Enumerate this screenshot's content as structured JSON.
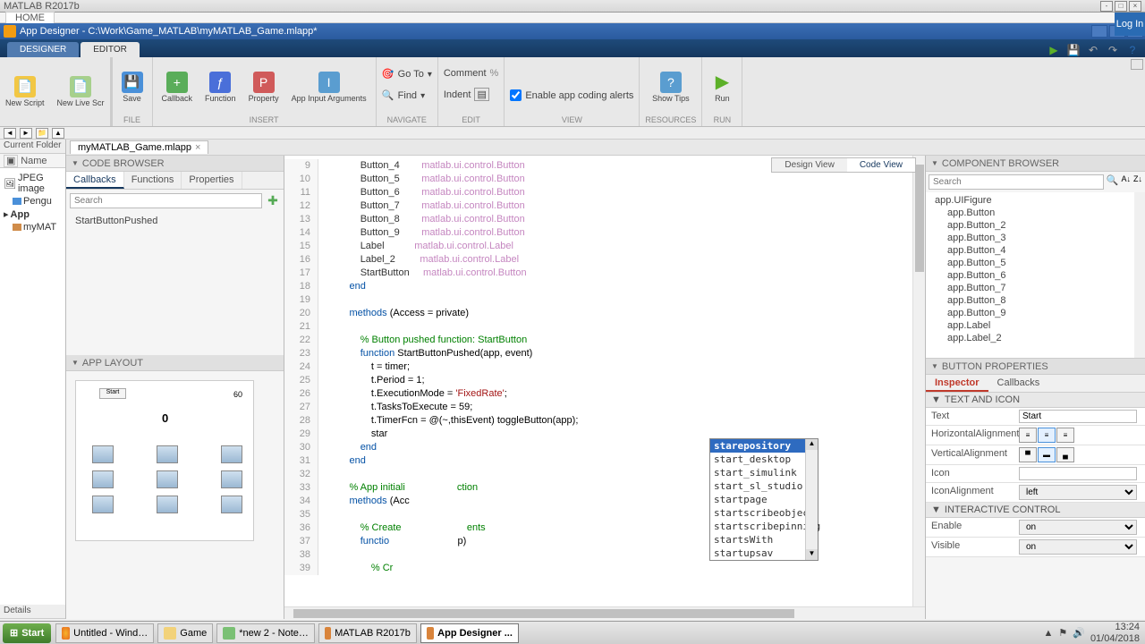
{
  "matlab_title": "MATLAB R2017b",
  "app_title": "App Designer - C:\\Work\\Game_MATLAB\\myMATLAB_Game.mlapp*",
  "home_tab": "HOME",
  "login": "Log In",
  "toolstrip": {
    "designer": "DESIGNER",
    "editor": "EDITOR"
  },
  "ribbon": {
    "new_script": "New\nScript",
    "new_livescript": "New\nLive Scr",
    "save": "Save",
    "callback": "Callback",
    "function": "Function",
    "property": "Property",
    "appinput": "App Input\nArguments",
    "goto": "Go To",
    "find": "Find",
    "comment": "Comment",
    "indent": "Indent",
    "enable_hints": "Enable app coding alerts",
    "show_tips": "Show Tips",
    "run": "Run",
    "g_file": "FILE",
    "g_insert": "INSERT",
    "g_navigate": "NAVIGATE",
    "g_edit": "EDIT",
    "g_view": "VIEW",
    "g_resources": "RESOURCES",
    "g_run": "RUN"
  },
  "current_folder": "Current Folder",
  "name_col": "Name",
  "folder_items": [
    "JPEG image",
    "Pengu",
    "App",
    "myMAT"
  ],
  "file_tab": "myMATLAB_Game.mlapp",
  "code_browser": {
    "title": "CODE BROWSER",
    "tabs": [
      "Callbacks",
      "Functions",
      "Properties"
    ],
    "search_ph": "Search",
    "item": "StartButtonPushed"
  },
  "app_layout": {
    "title": "APP LAYOUT",
    "start": "Start",
    "sixty": "60",
    "zero": "0"
  },
  "view_toggle": {
    "design": "Design View",
    "code": "Code View"
  },
  "code_lines": [
    {
      "n": 9,
      "indent": 3,
      "parts": [
        {
          "c": "prop",
          "t": "Button_4        "
        },
        {
          "c": "type",
          "t": "matlab.ui.control.Button"
        }
      ]
    },
    {
      "n": 10,
      "indent": 3,
      "parts": [
        {
          "c": "prop",
          "t": "Button_5        "
        },
        {
          "c": "type",
          "t": "matlab.ui.control.Button"
        }
      ]
    },
    {
      "n": 11,
      "indent": 3,
      "parts": [
        {
          "c": "prop",
          "t": "Button_6        "
        },
        {
          "c": "type",
          "t": "matlab.ui.control.Button"
        }
      ]
    },
    {
      "n": 12,
      "indent": 3,
      "parts": [
        {
          "c": "prop",
          "t": "Button_7        "
        },
        {
          "c": "type",
          "t": "matlab.ui.control.Button"
        }
      ]
    },
    {
      "n": 13,
      "indent": 3,
      "parts": [
        {
          "c": "prop",
          "t": "Button_8        "
        },
        {
          "c": "type",
          "t": "matlab.ui.control.Button"
        }
      ]
    },
    {
      "n": 14,
      "indent": 3,
      "parts": [
        {
          "c": "prop",
          "t": "Button_9        "
        },
        {
          "c": "type",
          "t": "matlab.ui.control.Button"
        }
      ]
    },
    {
      "n": 15,
      "indent": 3,
      "parts": [
        {
          "c": "prop",
          "t": "Label           "
        },
        {
          "c": "type",
          "t": "matlab.ui.control.Label"
        }
      ]
    },
    {
      "n": 16,
      "indent": 3,
      "parts": [
        {
          "c": "prop",
          "t": "Label_2         "
        },
        {
          "c": "type",
          "t": "matlab.ui.control.Label"
        }
      ]
    },
    {
      "n": 17,
      "indent": 3,
      "parts": [
        {
          "c": "prop",
          "t": "StartButton     "
        },
        {
          "c": "type",
          "t": "matlab.ui.control.Button"
        }
      ]
    },
    {
      "n": 18,
      "indent": 2,
      "parts": [
        {
          "c": "kw",
          "t": "end"
        }
      ]
    },
    {
      "n": 19,
      "indent": 0,
      "parts": []
    },
    {
      "n": 20,
      "indent": 2,
      "parts": [
        {
          "c": "kw",
          "t": "methods"
        },
        {
          "c": "",
          "t": " (Access = private)"
        }
      ]
    },
    {
      "n": 21,
      "indent": 0,
      "parts": []
    },
    {
      "n": 22,
      "indent": 3,
      "parts": [
        {
          "c": "cmt",
          "t": "% Button pushed function: StartButton"
        }
      ]
    },
    {
      "n": 23,
      "indent": 3,
      "parts": [
        {
          "c": "kw",
          "t": "function"
        },
        {
          "c": "",
          "t": " StartButtonPushed(app, event)"
        }
      ]
    },
    {
      "n": 24,
      "indent": 4,
      "parts": [
        {
          "c": "",
          "t": "t = timer;"
        }
      ]
    },
    {
      "n": 25,
      "indent": 4,
      "parts": [
        {
          "c": "",
          "t": "t.Period = 1;"
        }
      ]
    },
    {
      "n": 26,
      "indent": 4,
      "parts": [
        {
          "c": "",
          "t": "t.ExecutionMode = "
        },
        {
          "c": "str",
          "t": "'FixedRate'"
        },
        {
          "c": "",
          "t": ";"
        }
      ]
    },
    {
      "n": 27,
      "indent": 4,
      "parts": [
        {
          "c": "",
          "t": "t.TasksToExecute = 59;"
        }
      ]
    },
    {
      "n": 28,
      "indent": 4,
      "parts": [
        {
          "c": "",
          "t": "t.TimerFcn = @(~,thisEvent) toggleButton(app);"
        }
      ]
    },
    {
      "n": 29,
      "indent": 4,
      "parts": [
        {
          "c": "",
          "t": "star"
        }
      ]
    },
    {
      "n": 30,
      "indent": 3,
      "parts": [
        {
          "c": "kw",
          "t": "end"
        }
      ]
    },
    {
      "n": 31,
      "indent": 2,
      "parts": [
        {
          "c": "kw",
          "t": "end"
        }
      ]
    },
    {
      "n": 32,
      "indent": 0,
      "parts": []
    },
    {
      "n": 33,
      "indent": 2,
      "parts": [
        {
          "c": "cmt",
          "t": "% App initiali                   ction"
        }
      ]
    },
    {
      "n": 34,
      "indent": 2,
      "parts": [
        {
          "c": "kw",
          "t": "methods"
        },
        {
          "c": "",
          "t": " (Acc"
        }
      ]
    },
    {
      "n": 35,
      "indent": 0,
      "parts": []
    },
    {
      "n": 36,
      "indent": 3,
      "parts": [
        {
          "c": "cmt",
          "t": "% Create                        ents"
        }
      ]
    },
    {
      "n": 37,
      "indent": 3,
      "parts": [
        {
          "c": "kw",
          "t": "functio"
        },
        {
          "c": "",
          "t": "                         p)"
        }
      ]
    },
    {
      "n": 38,
      "indent": 0,
      "parts": []
    },
    {
      "n": 39,
      "indent": 4,
      "parts": [
        {
          "c": "cmt",
          "t": "% Cr"
        }
      ]
    }
  ],
  "autocomplete": [
    "starepository",
    "start_desktop",
    "start_simulink",
    "start_sl_studio",
    "startpage",
    "startscribeobject",
    "startscribepinning",
    "startsWith",
    "startupsav"
  ],
  "comp_browser": {
    "title": "COMPONENT BROWSER",
    "search_ph": "Search",
    "items": [
      "app.UIFigure",
      "app.Button",
      "app.Button_2",
      "app.Button_3",
      "app.Button_4",
      "app.Button_5",
      "app.Button_6",
      "app.Button_7",
      "app.Button_8",
      "app.Button_9",
      "app.Label",
      "app.Label_2"
    ]
  },
  "button_props": {
    "title": "BUTTON PROPERTIES",
    "tabs": [
      "Inspector",
      "Callbacks"
    ],
    "sec_text": "TEXT AND ICON",
    "sec_interactive": "INTERACTIVE CONTROL",
    "text_lbl": "Text",
    "text_val": "Start",
    "halign_lbl": "HorizontalAlignment",
    "valign_lbl": "VerticalAlignment",
    "icon_lbl": "Icon",
    "iconalign_lbl": "IconAlignment",
    "iconalign_val": "left",
    "enable_lbl": "Enable",
    "enable_val": "on",
    "visible_lbl": "Visible",
    "visible_val": "on"
  },
  "details": "Details",
  "taskbar": {
    "start": "Start",
    "items": [
      "Untitled - Wind…",
      "Game",
      "*new  2 - Note…",
      "MATLAB R2017b",
      "App Designer ..."
    ],
    "time": "13:24",
    "date": "01/04/2018"
  }
}
